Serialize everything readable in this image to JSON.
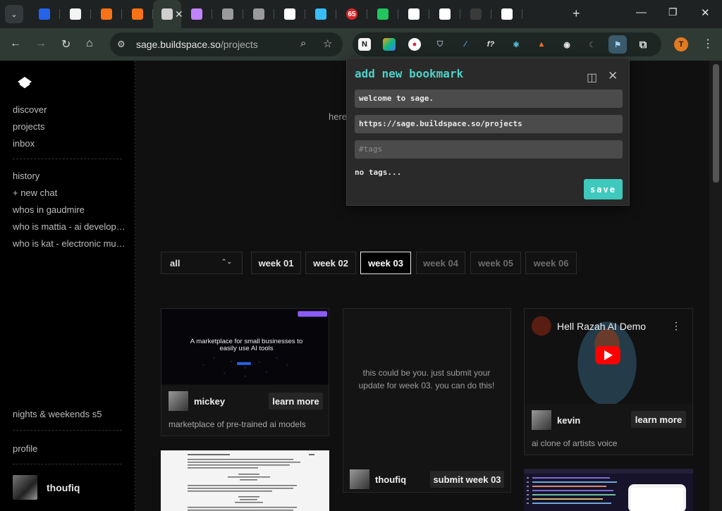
{
  "browser": {
    "url_host": "sage.buildspace.so",
    "url_path": "/projects",
    "profile_initial": "T",
    "tabs": [
      {
        "icon": "dashboard-icon",
        "color": "#2563eb"
      },
      {
        "icon": "dice-icon",
        "color": "#f4f4f4"
      },
      {
        "icon": "fire-icon",
        "color": "#f97316"
      },
      {
        "icon": "fire-icon",
        "color": "#f97316"
      },
      {
        "icon": "buildspace-icon",
        "color": "#cfcfcf",
        "active": true
      },
      {
        "icon": "app-icon",
        "color": "#c084fc"
      },
      {
        "icon": "buildspace-icon",
        "color": "#9a9a9a"
      },
      {
        "icon": "buildspace-icon",
        "color": "#9a9a9a"
      },
      {
        "icon": "slash-icon",
        "color": "#ffffff"
      },
      {
        "icon": "tailwind-icon",
        "color": "#38bdf8"
      },
      {
        "icon": "notification-badge-icon",
        "color": "#dc2626",
        "badge": "65"
      },
      {
        "icon": "colorful-icon",
        "color": "#22c55e"
      },
      {
        "icon": "triangle-icon",
        "color": "#ffffff"
      },
      {
        "icon": "x-icon",
        "color": "#ffffff"
      },
      {
        "icon": "github-icon",
        "color": "#3a3a3a"
      },
      {
        "icon": "triangle-icon",
        "color": "#ffffff"
      }
    ]
  },
  "sidebar": {
    "primary": [
      "discover",
      "projects",
      "inbox"
    ],
    "history": [
      "history",
      "+ new chat",
      "whos in gaudmire",
      "who is mattia - ai developer...",
      "who is kat - electronic musi..."
    ],
    "program": "nights & weekends s5",
    "profile": "profile",
    "user": "thoufiq"
  },
  "main": {
    "hero_text": "here",
    "filter": {
      "selected": "all"
    },
    "weeks": [
      {
        "label": "week 01",
        "state": "normal"
      },
      {
        "label": "week 02",
        "state": "normal"
      },
      {
        "label": "week 03",
        "state": "active"
      },
      {
        "label": "week 04",
        "state": "dim"
      },
      {
        "label": "week 05",
        "state": "dim"
      },
      {
        "label": "week 06",
        "state": "dim"
      }
    ],
    "cards": {
      "mickey": {
        "thumb_title": "A marketplace for small businesses to easily use AI tools",
        "user": "mickey",
        "button": "learn more",
        "desc": "marketplace of pre-trained ai models"
      },
      "placeholder": {
        "text": "this could be you. just submit your update for week 03. you can do this!",
        "user": "thoufiq",
        "button": "submit week 03"
      },
      "kevin": {
        "video_title": "Hell Razah AI Demo",
        "user": "kevin",
        "button": "learn more",
        "desc": "ai clone of artists voice"
      }
    }
  },
  "bookmark": {
    "title": "add new bookmark",
    "name_value": "welcome to sage.",
    "url_value": "https://sage.buildspace.so/projects",
    "tags_placeholder": "#tags",
    "no_tags": "no tags...",
    "save": "save"
  },
  "colors": {
    "accent": "#3fc9bd",
    "title": "#4fd1c8"
  }
}
